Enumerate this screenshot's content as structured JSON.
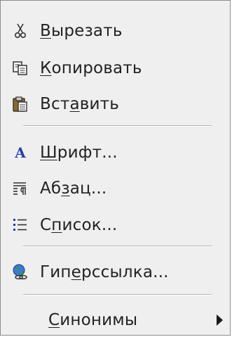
{
  "menu": {
    "items": [
      {
        "id": "cut",
        "label": "Вырезать",
        "mnemonic_index": 0,
        "icon": "scissors-icon"
      },
      {
        "id": "copy",
        "label": "Копировать",
        "mnemonic_index": 0,
        "icon": "copy-icon"
      },
      {
        "id": "paste",
        "label": "Вставить",
        "mnemonic_index": 3,
        "icon": "clipboard-paste-icon"
      },
      {
        "id": "font",
        "label": "Шрифт...",
        "mnemonic_index": 0,
        "icon": "font-icon"
      },
      {
        "id": "paragraph",
        "label": "Абзац...",
        "mnemonic_index": 2,
        "icon": "paragraph-icon"
      },
      {
        "id": "list",
        "label": "Список...",
        "mnemonic_index": 1,
        "icon": "bullet-list-icon"
      },
      {
        "id": "hyperlink",
        "label": "Гиперссылка...",
        "mnemonic_index": 3,
        "icon": "globe-link-icon"
      },
      {
        "id": "synonyms",
        "label": "Синонимы",
        "mnemonic_index": 0,
        "icon": "",
        "submenu": true
      }
    ],
    "colors": {
      "background": "#efefef",
      "text": "#222222",
      "font_icon_blue": "#2b3ea8",
      "list_icon_blue": "#1f3fbf"
    }
  }
}
